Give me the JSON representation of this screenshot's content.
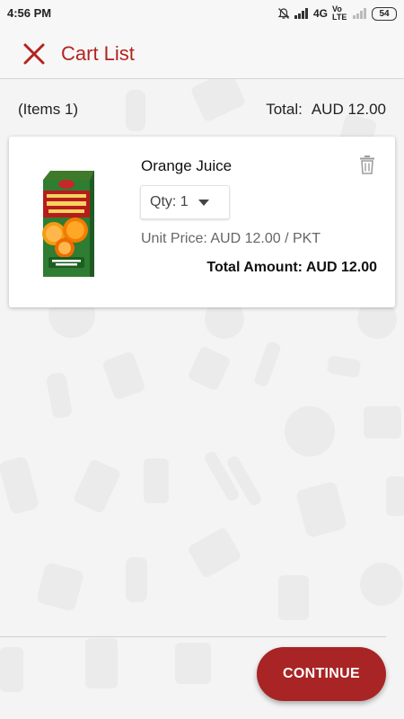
{
  "status_bar": {
    "time": "4:56 PM",
    "network": "4G",
    "carrier_label": "Vo LTE",
    "battery": "54",
    "icons": [
      "mute-icon",
      "signal-icon",
      "signal-weak-icon",
      "battery-icon"
    ]
  },
  "header": {
    "title": "Cart List",
    "close_icon": "close-icon"
  },
  "summary": {
    "items_label": "(Items 1)",
    "total_label": "Total:",
    "total_value": "AUD 12.00"
  },
  "cart_items": [
    {
      "name": "Orange Juice",
      "qty_label": "Qty: 1",
      "unit_price": "Unit Price: AUD 12.00 / PKT",
      "total_amount": "Total Amount: AUD 12.00",
      "delete_icon": "trash-icon",
      "image": "orange-juice-carton"
    }
  ],
  "footer": {
    "continue_label": "CONTINUE"
  },
  "colors": {
    "accent": "#b3241f",
    "button": "#a92424",
    "background": "#f4f4f4",
    "card": "#ffffff"
  }
}
